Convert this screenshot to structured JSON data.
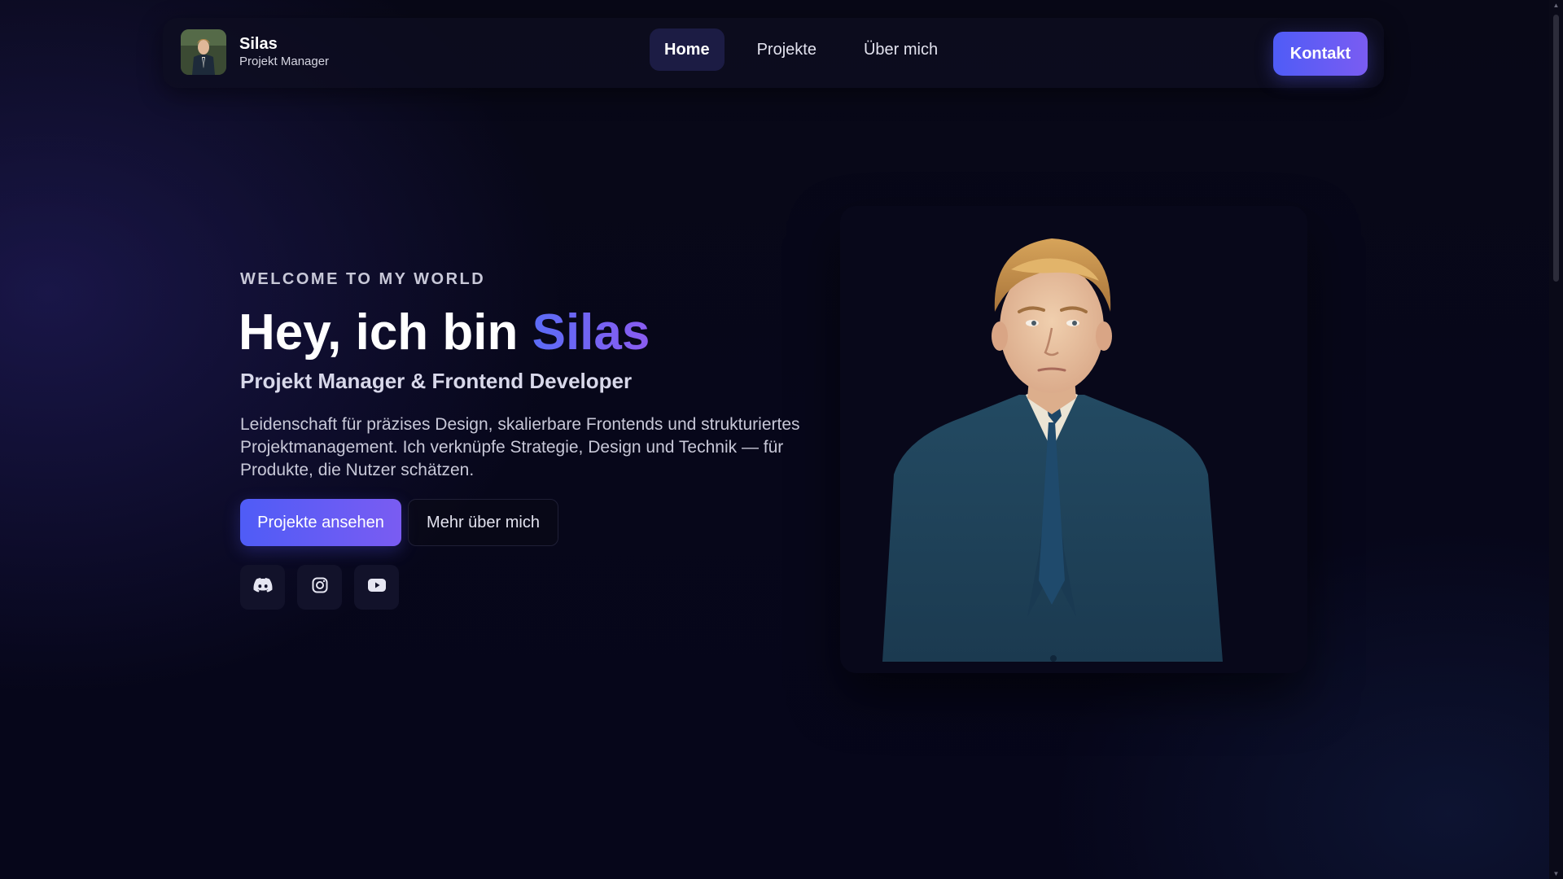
{
  "brand": {
    "name": "Silas",
    "role": "Projekt Manager",
    "avatar_icon": "avatar"
  },
  "nav": {
    "items": [
      {
        "label": "Home",
        "active": true
      },
      {
        "label": "Projekte",
        "active": false
      },
      {
        "label": "Über mich",
        "active": false
      }
    ],
    "contact_label": "Kontakt"
  },
  "hero": {
    "eyebrow": "WELCOME TO MY WORLD",
    "title_prefix": "Hey, ich bin ",
    "title_name": "Silas",
    "subtitle": "Projekt Manager & Frontend Developer",
    "description": "Leidenschaft für präzises Design, skalierbare Frontends und strukturiertes Projektmanagement. Ich verknüpfe Strategie, Design und Technik — für Produkte, die Nutzer schätzen.",
    "primary_button": "Projekte ansehen",
    "secondary_button": "Mehr über mich"
  },
  "socials": [
    {
      "icon": "discord-icon"
    },
    {
      "icon": "instagram-icon"
    },
    {
      "icon": "youtube-icon"
    }
  ],
  "colors": {
    "accent_start": "#4f5cf6",
    "accent_end": "#7a5cf2",
    "background": "#060612"
  }
}
